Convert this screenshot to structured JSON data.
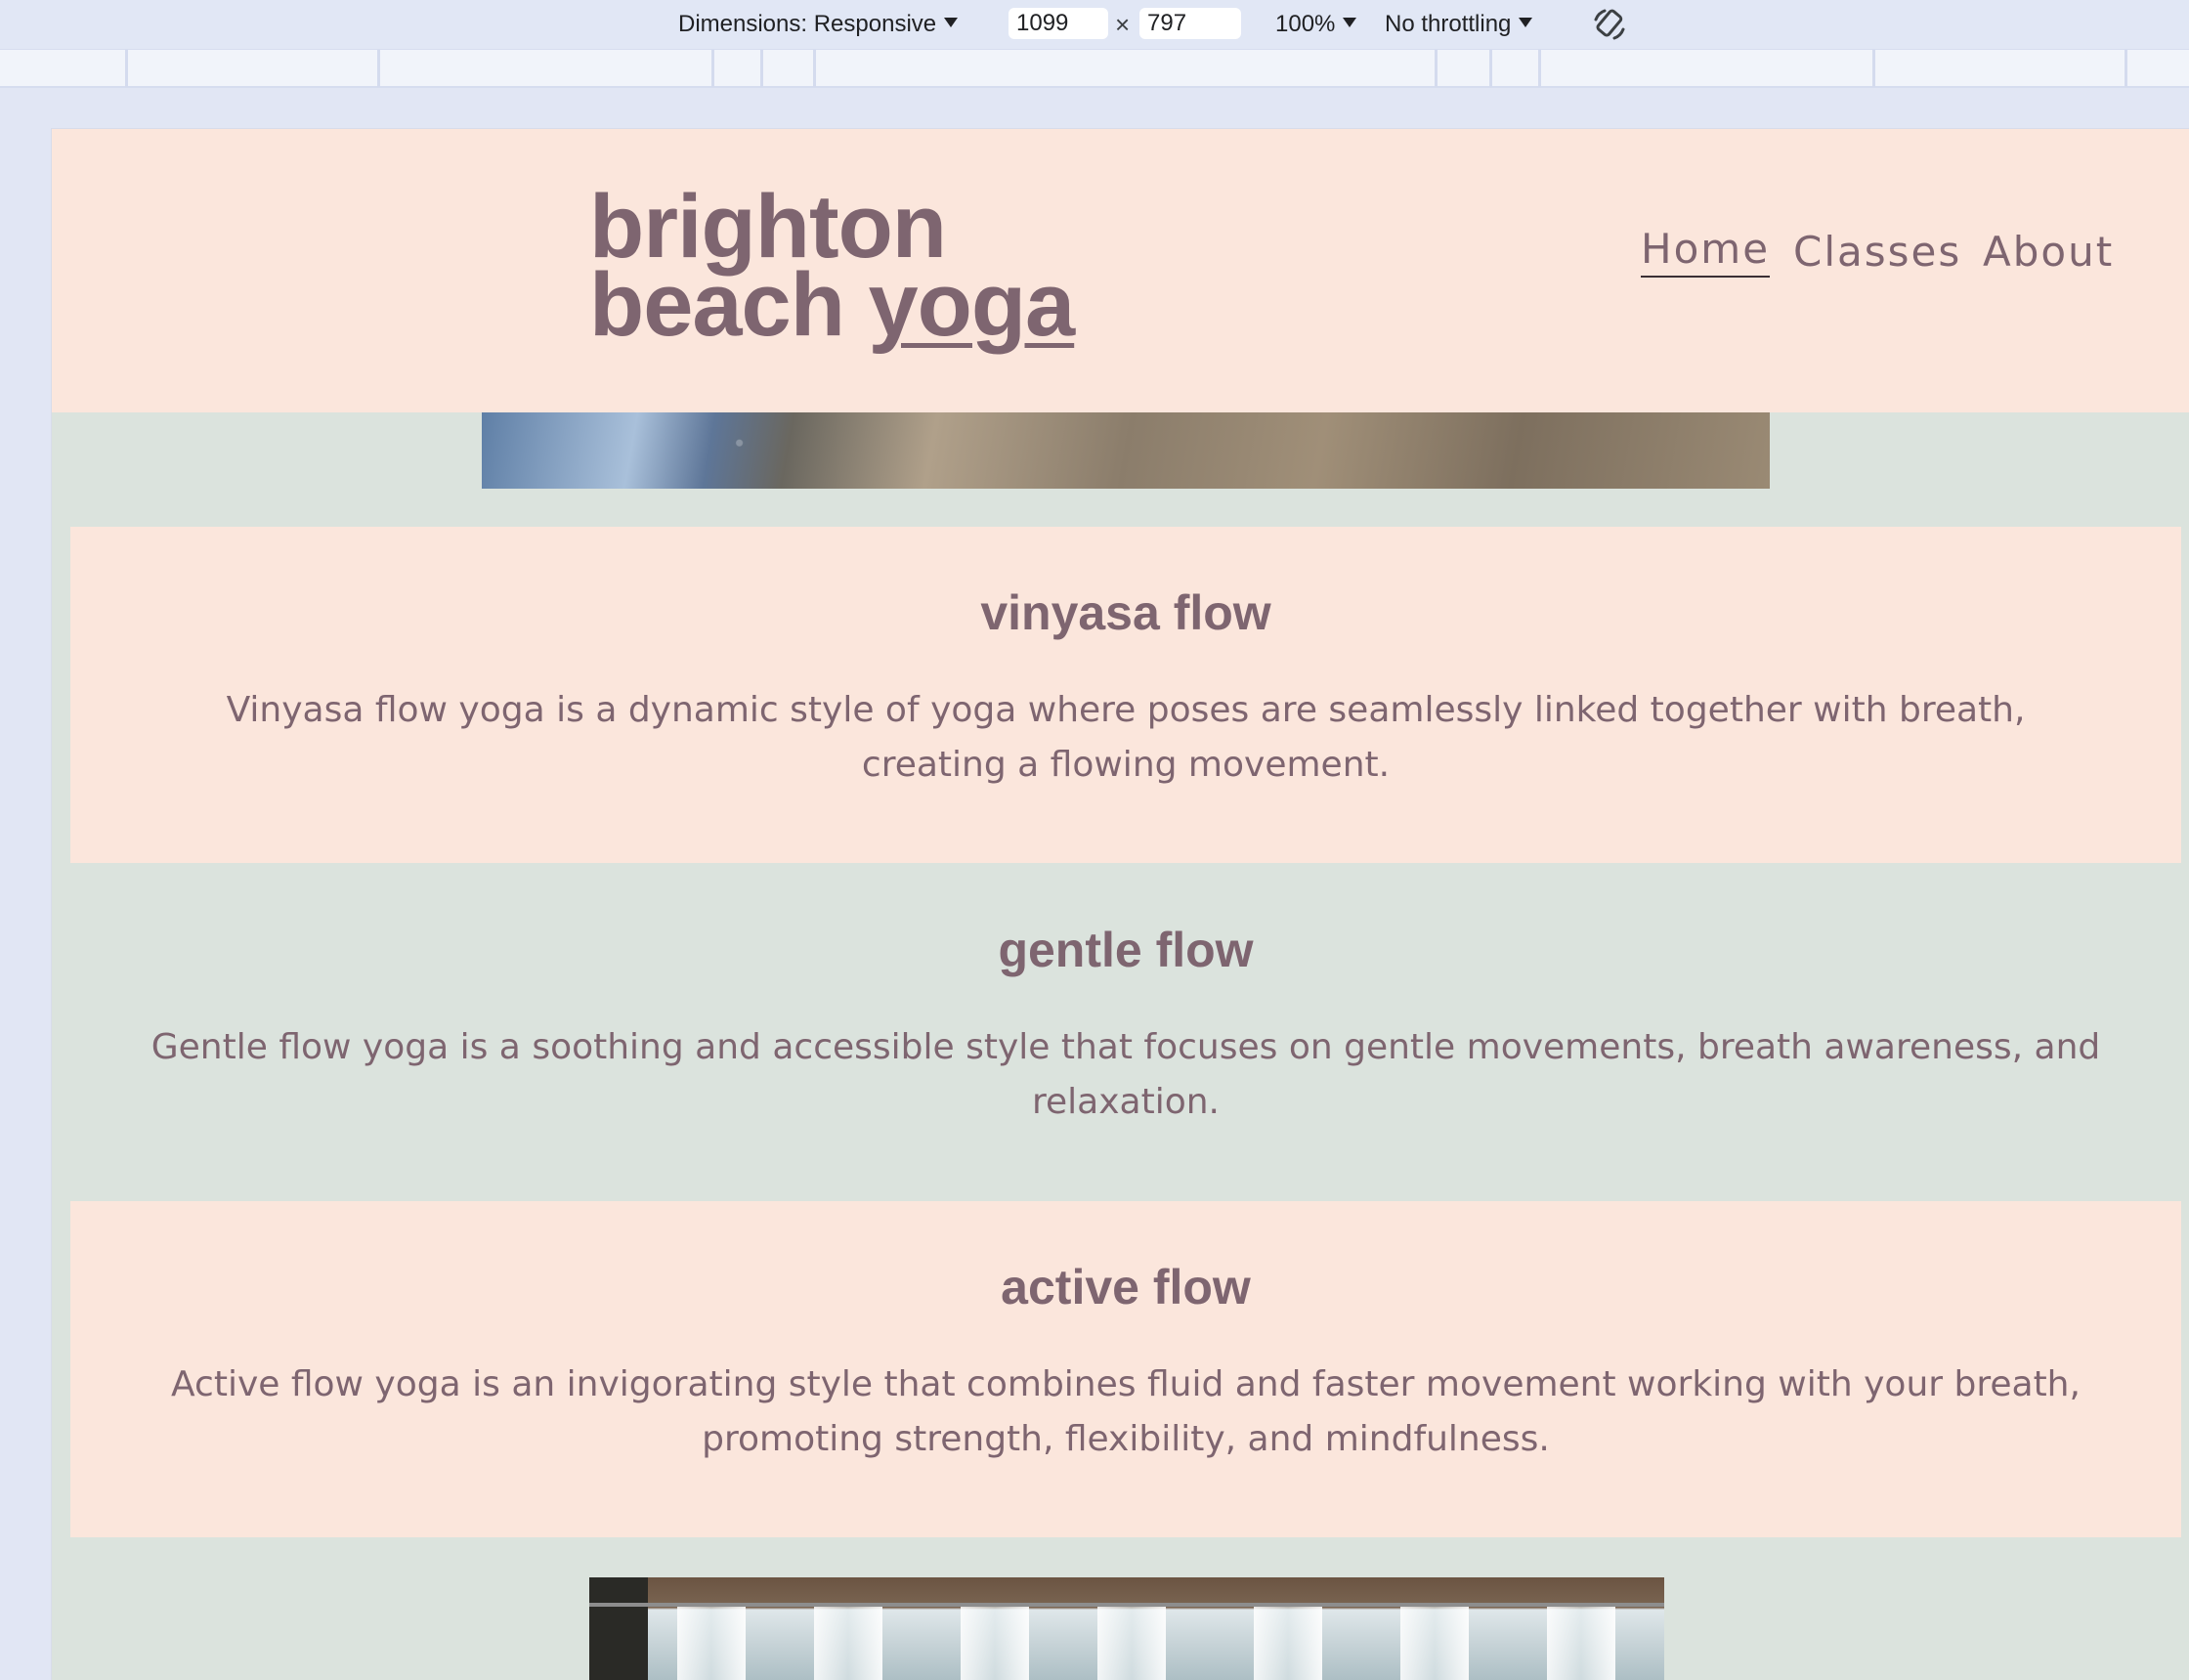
{
  "devtools": {
    "dimensions_label": "Dimensions: Responsive",
    "width_value": "1099",
    "height_value": "797",
    "times": "×",
    "zoom_label": "100%",
    "throttling_label": "No throttling"
  },
  "site": {
    "logo_line1": "brighton",
    "logo_line2_a": "beach ",
    "logo_line2_b": "yoga",
    "nav": {
      "home": "Home",
      "classes": "Classes",
      "about": "About"
    },
    "sections": [
      {
        "title": "vinyasa flow",
        "text": "Vinyasa flow yoga is a dynamic style of yoga where poses are seamlessly linked together with breath, creating a flowing movement."
      },
      {
        "title": "gentle flow",
        "text": "Gentle flow yoga is a soothing and accessible style that focuses on gentle movements, breath awareness, and relaxation."
      },
      {
        "title": "active flow",
        "text": "Active flow yoga is an invigorating style that combines fluid and faster movement working with your breath, promoting strength, flexibility, and mindfulness."
      }
    ]
  },
  "colors": {
    "header_bg": "#fbe6dc",
    "page_bg": "#dbe3dd",
    "text": "#7e6570"
  }
}
